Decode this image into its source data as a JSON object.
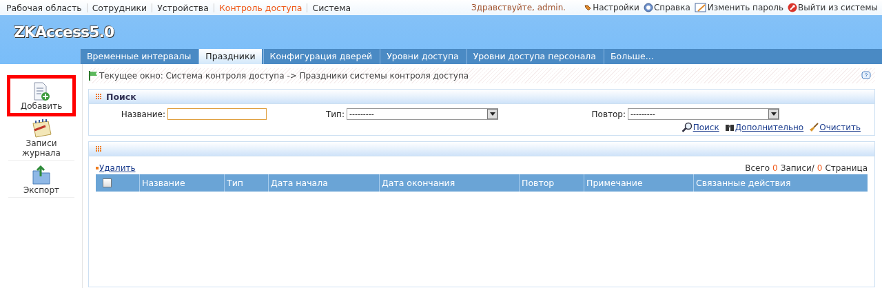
{
  "top_menu": [
    {
      "label": "Рабочая область",
      "selected": false
    },
    {
      "label": "Сотрудники",
      "selected": false
    },
    {
      "label": "Устройства",
      "selected": false
    },
    {
      "label": "Контроль доступа",
      "selected": true
    },
    {
      "label": "Система",
      "selected": false
    }
  ],
  "greeting": "Здравствуйте, admin.",
  "user_links": [
    {
      "label": "Настройки",
      "kind": "settings"
    },
    {
      "label": "Справка",
      "kind": "help"
    },
    {
      "label": "Изменить пароль",
      "kind": "password"
    },
    {
      "label": "Выйти из системы",
      "kind": "logout"
    }
  ],
  "logo": "ZKAccess5.0",
  "tabs": [
    {
      "label": "Временные интервалы",
      "selected": false
    },
    {
      "label": "Праздники",
      "selected": true
    },
    {
      "label": "Конфигурация дверей",
      "selected": false
    },
    {
      "label": "Уровни доступа",
      "selected": false
    },
    {
      "label": "Уровни доступа персонала",
      "selected": false
    },
    {
      "label": "Больше...",
      "selected": false
    }
  ],
  "sidebar": {
    "items": [
      {
        "label": "Добавить",
        "kind": "add",
        "highlighted": true
      },
      {
        "label": "Записи журнала",
        "kind": "log",
        "highlighted": false
      },
      {
        "label": "Экспорт",
        "kind": "export",
        "highlighted": false
      }
    ]
  },
  "breadcrumb": "Текущее окно: Система контроля доступа -> Праздники системы контроля доступа",
  "search": {
    "title": "Поиск",
    "fields": [
      {
        "label": "Название:",
        "kind": "text"
      },
      {
        "label": "Тип:",
        "kind": "select",
        "value": "---------"
      },
      {
        "label": "Повтор:",
        "kind": "select",
        "value": "---------"
      }
    ],
    "actions": [
      {
        "label": "Поиск",
        "kind": "search"
      },
      {
        "label": "Дополнительно",
        "kind": "advanced"
      },
      {
        "label": "Очистить",
        "kind": "clear"
      }
    ]
  },
  "list": {
    "delete_link": "Удалить",
    "summary": [
      "Всего",
      "0",
      "Записи/",
      "0",
      "Страница"
    ],
    "table": {
      "select_all": {
        "checked": false
      },
      "columns": [
        "Название",
        "Тип",
        "Дата начала",
        "Дата окончания",
        "Повтор",
        "Примечание",
        "Связанные действия"
      ]
    }
  }
}
